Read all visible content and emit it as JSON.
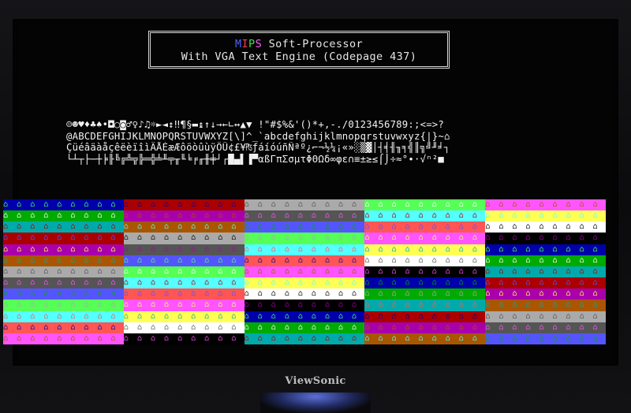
{
  "title_box": {
    "line1_parts": [
      "M",
      "I",
      "P",
      "S",
      " Soft-Processor"
    ],
    "line2": "With VGA Text Engine (Codepage 437)"
  },
  "charset_rows": [
    "☺☻♥♦♣♠•◘○◙♂♀♪♫☼►◄↕‼¶§▬↨↑↓→←∟↔▲▼ !\"#$%&'()*+,-./0123456789:;<=>?",
    "@ABCDEFGHIJKLMNOPQRSTUVWXYZ[\\]^_`abcdefghijklmnopqrstuvwxyz{|}~⌂",
    "ÇüéâäàåçêëèïîìÄÅÉæÆôöòûùÿÖÜ¢£¥₧ƒáíóúñÑªº¿⌐¬½¼¡«»░▒▓│┤╡╢╖╕╣║╗╝╜╛┐",
    "└┴┬├─┼╞╟╚╔╩╦╠═╬╧╨╤╥╙╘╒╓╫╪┘┌█▄▌▐▀αßΓπΣσµτΦΘΩδ∞φε∩≡±≥≤⌠⌡÷≈°∙·√ⁿ²■"
  ],
  "grid_glyph": "⌂",
  "palette": [
    "#0000aa",
    "#00aa00",
    "#00aaaa",
    "#aa0000",
    "#aa00aa",
    "#aa5500",
    "#aaaaaa",
    "#555555",
    "#5555ff",
    "#55ff55",
    "#55ffff",
    "#ff5555",
    "#ff55ff",
    "#ffff55",
    "#ffffff",
    "#000000"
  ],
  "brand": "ViewSonic"
}
